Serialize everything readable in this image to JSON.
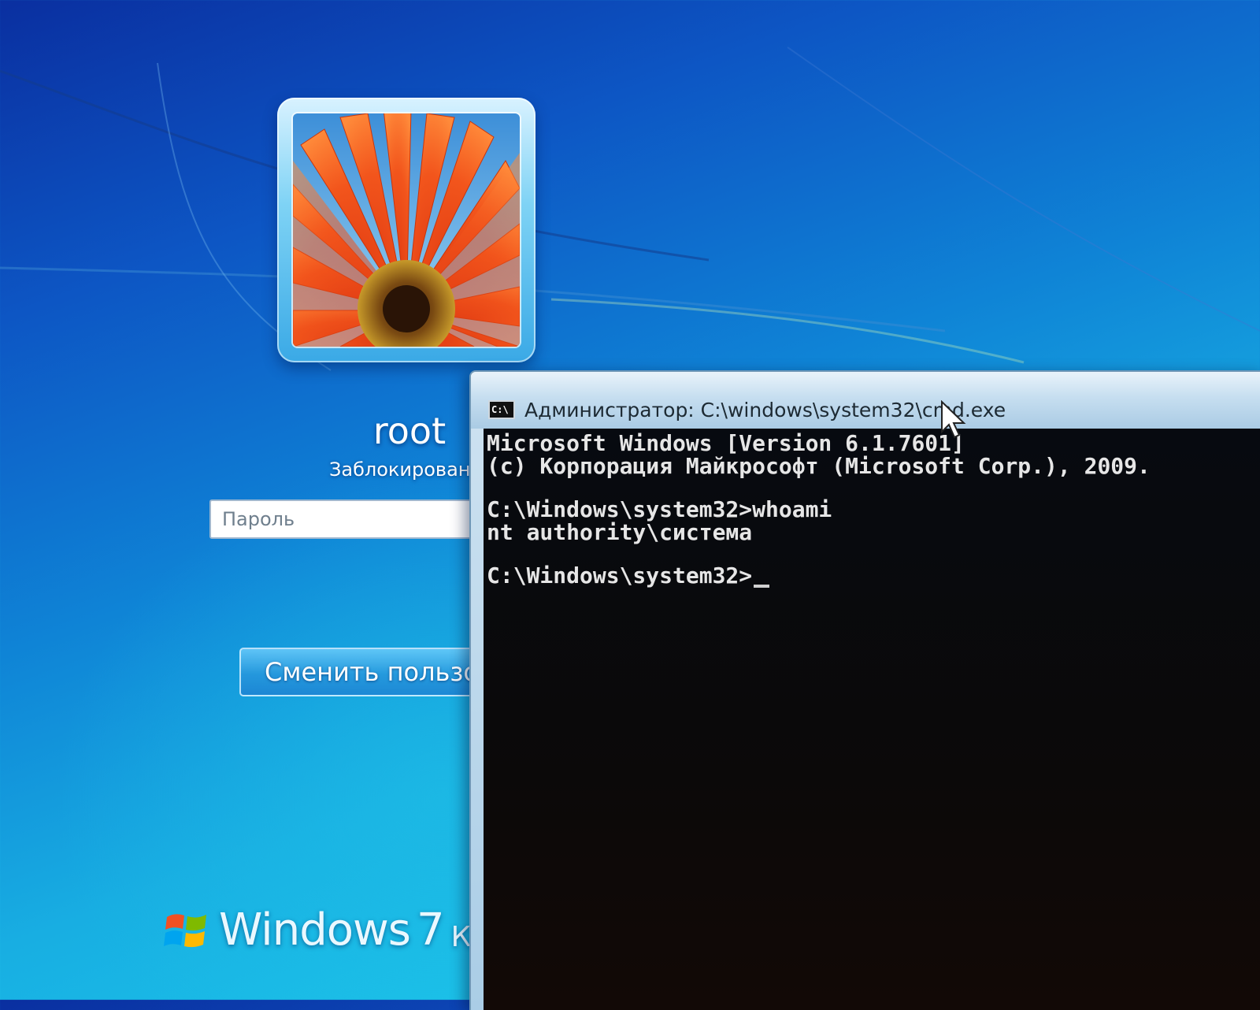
{
  "login": {
    "username": "root",
    "status": "Заблокирован",
    "password_placeholder": "Пароль",
    "switch_user_label": "Сменить пользо"
  },
  "branding": {
    "product": "Windows",
    "version": "7",
    "edition": "Кор"
  },
  "cmd": {
    "title": "Администратор: C:\\windows\\system32\\cmd.exe",
    "icon_text": "C:\\",
    "lines": [
      "Microsoft Windows [Version 6.1.7601]",
      "(c) Корпорация Майкрософт (Microsoft Corp.), 2009.",
      "",
      "C:\\Windows\\system32>whoami",
      "nt authority\\система",
      "",
      "C:\\Windows\\system32>"
    ]
  },
  "colors": {
    "console_text": "#e6e6e6",
    "desktop_blue": "#0f84d6"
  }
}
